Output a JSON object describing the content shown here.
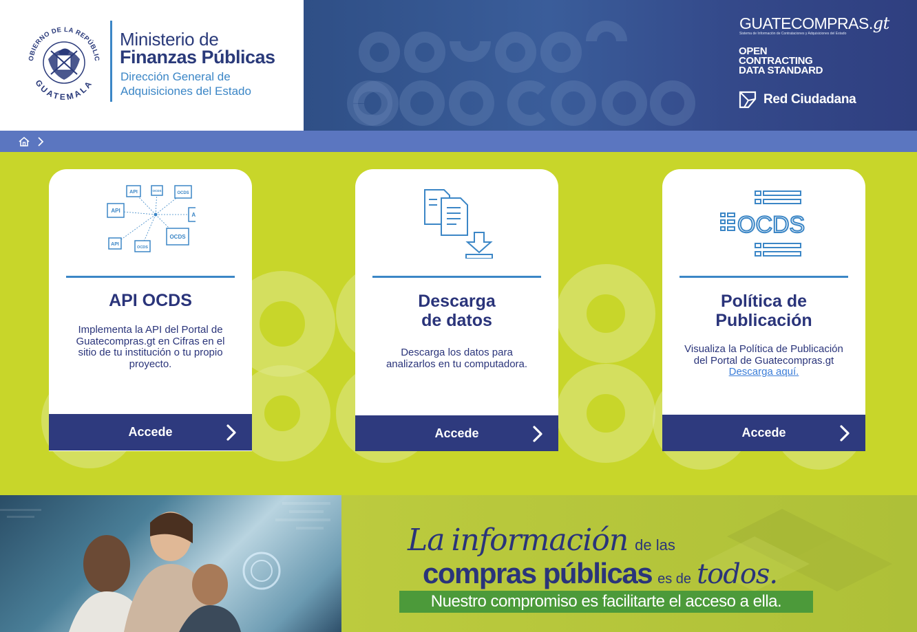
{
  "header": {
    "ministry_line1": "Ministerio de",
    "ministry_line2": "Finanzas Públicas",
    "ministry_line3": "Dirección General de",
    "ministry_line4": "Adquisiciones del Estado",
    "seal_text_top": "GOBIERNO DE LA REPÚBLICA",
    "seal_text_bottom": "GUATEMALA",
    "guatecompras": "GUATECOMPRAS.",
    "guatecompras_gt": "gt",
    "guatecompras_sub": "Sistema de Información de Contrataciones y Adquisiciones del Estado",
    "ocds_line1": "OPEN",
    "ocds_line2": "CONTRACTING",
    "ocds_line3": "DATA STANDARD",
    "red_ciudadana": "Red Ciudadana"
  },
  "breadcrumb": {
    "home_icon": "home-icon",
    "separator_icon": "chevron-right-icon"
  },
  "cards": [
    {
      "title": "API OCDS",
      "description": "Implementa la API del Portal de Guatecompras.gt en Cifras en el sitio de tu institución o tu propio proyecto.",
      "link": "",
      "button": "Accede",
      "icon": "api-network-icon"
    },
    {
      "title": "Descarga de datos",
      "description": "Descarga los datos para analizarlos en tu computadora.",
      "link": "",
      "button": "Accede",
      "icon": "document-download-icon"
    },
    {
      "title": "Política de Publicación",
      "description": "Visualiza la Política de Publicación del Portal de Guatecompras.gt",
      "link": "Descarga aquí.",
      "button": "Accede",
      "icon": "ocds-list-icon"
    }
  ],
  "api_icon_labels": {
    "api": "API",
    "ocds": "OCDS"
  },
  "ocds_icon_text": "OCDS",
  "banner": {
    "la": "La",
    "informacion": "información",
    "de_las": "de las",
    "compras_publicas": "compras públicas",
    "es_de": "es de",
    "todos": "todos.",
    "commitment": "Nuestro compromiso es facilitarte el acceso a ella."
  },
  "colors": {
    "navy": "#2e3a7e",
    "lime": "#c8d62a",
    "blue": "#3b86c6",
    "breadcrumb": "#5b76c0"
  }
}
